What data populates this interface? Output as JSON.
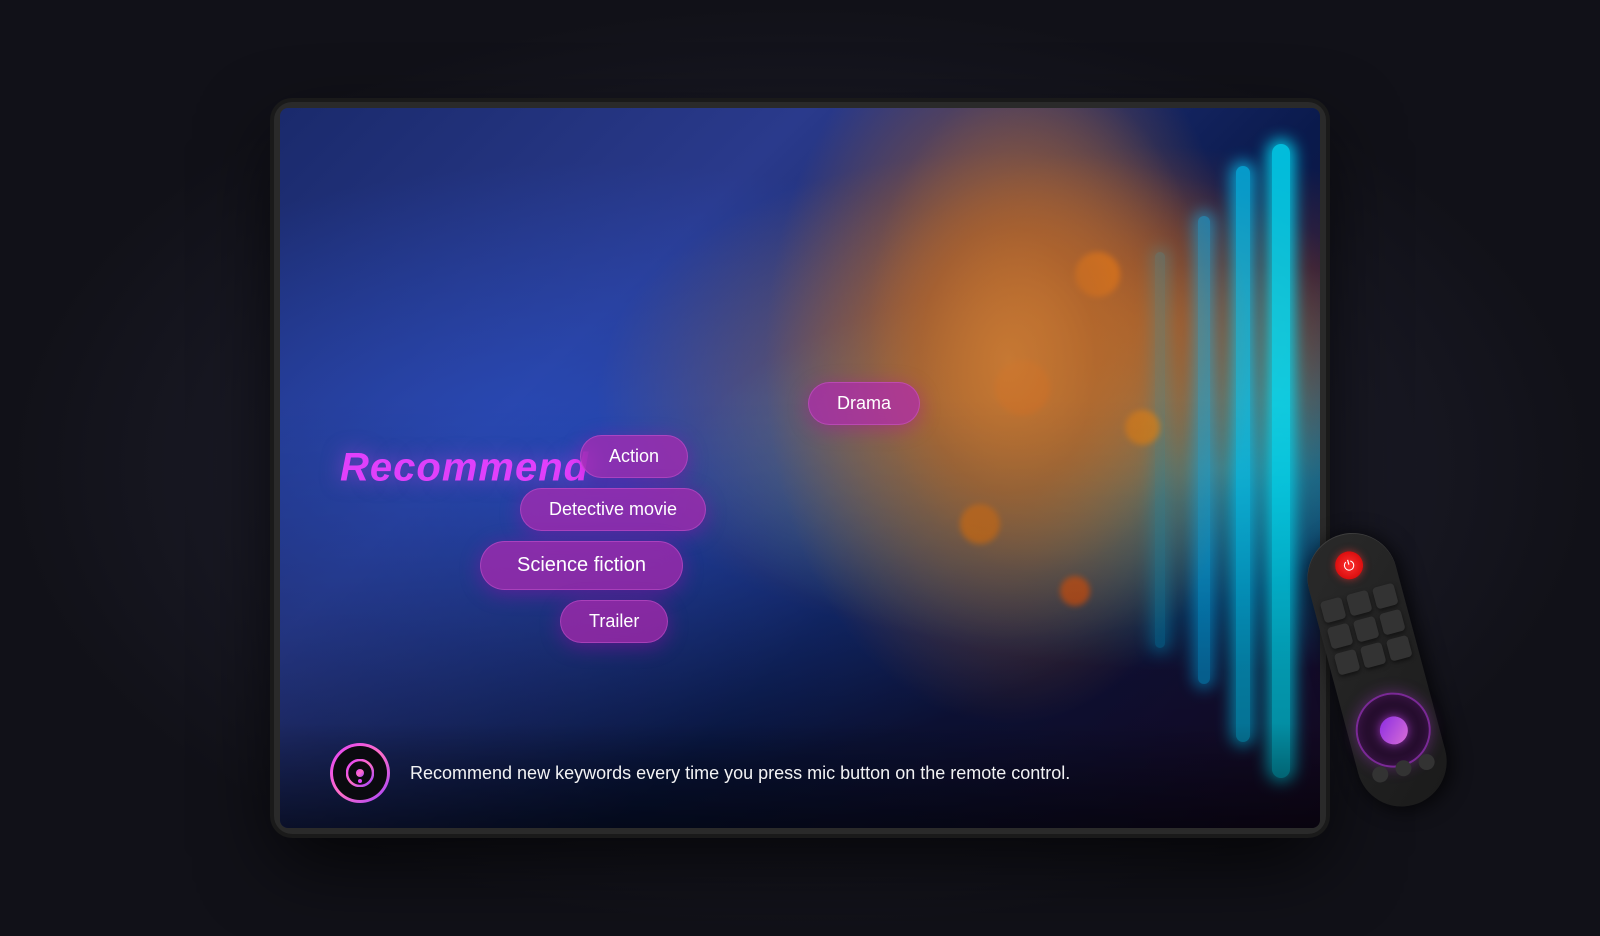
{
  "screen": {
    "recommend_label": "Recommend",
    "genres": [
      {
        "id": "drama",
        "label": "Drama",
        "size": "normal",
        "row": 1
      },
      {
        "id": "action",
        "label": "Action",
        "size": "normal",
        "row": 2
      },
      {
        "id": "detective",
        "label": "Detective movie",
        "size": "normal",
        "row": 3
      },
      {
        "id": "scifi",
        "label": "Science fiction",
        "size": "large",
        "row": 4
      },
      {
        "id": "trailer",
        "label": "Trailer",
        "size": "normal",
        "row": 5
      }
    ],
    "bottom_text": "Recommend new keywords every time you press mic button on the remote control.",
    "colors": {
      "recommend": "#e040fb",
      "bubble_bg": "rgba(180,40,180,0.7)",
      "accent": "#e040fb"
    }
  }
}
